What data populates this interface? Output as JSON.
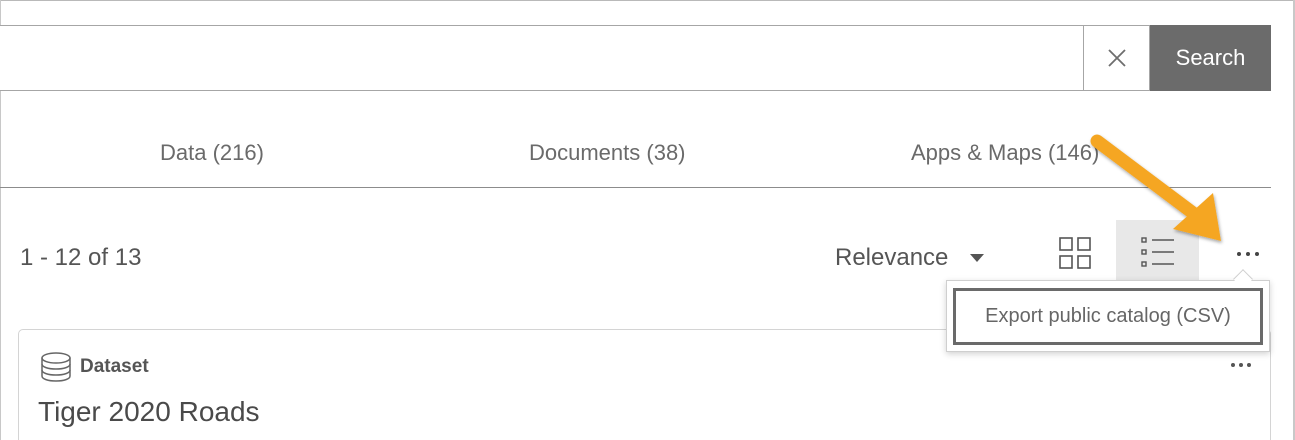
{
  "search": {
    "value": "",
    "placeholder": "",
    "button_label": "Search",
    "clear_icon": "close-icon"
  },
  "tabs": [
    {
      "label": "Data (216)"
    },
    {
      "label": "Documents (38)"
    },
    {
      "label": "Apps & Maps (146)"
    }
  ],
  "toolbar": {
    "result_count": "1 - 12 of 13",
    "sort_label": "Relevance",
    "grid_view_icon": "grid-icon",
    "list_view_icon": "list-icon",
    "more_icon": "ellipsis-icon"
  },
  "menu": {
    "items": [
      {
        "label": "Export public catalog (CSV)"
      }
    ]
  },
  "results": [
    {
      "type_icon": "database-icon",
      "type_label": "Dataset",
      "title": "Tiger 2020 Roads",
      "more_icon": "ellipsis-icon"
    }
  ],
  "annotation": {
    "arrow_color": "#f5a623"
  },
  "colors": {
    "search_button": "#6b6b6b",
    "selected_view": "#e8e8e8"
  }
}
